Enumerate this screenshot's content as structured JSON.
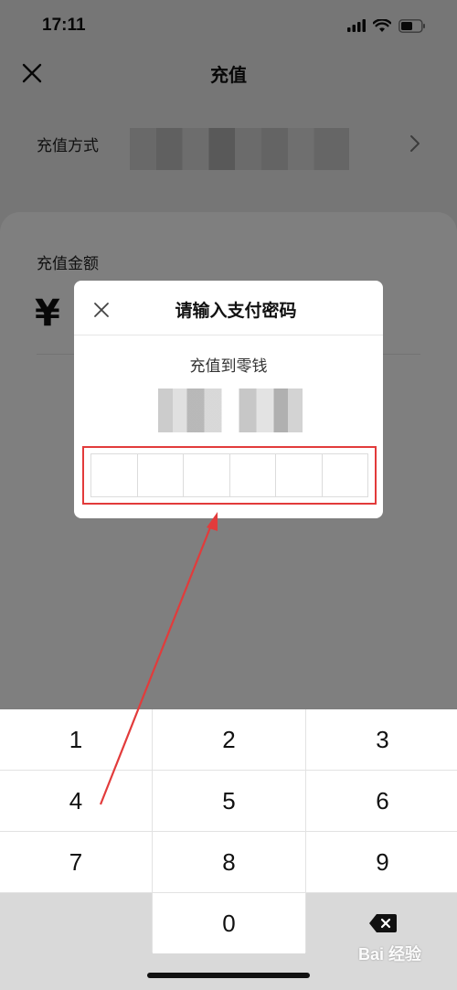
{
  "status_bar": {
    "time": "17:11",
    "icons": [
      "signal-icon",
      "wifi-icon",
      "battery-icon"
    ]
  },
  "nav": {
    "title": "充值",
    "close_icon": "close-icon"
  },
  "recharge_method": {
    "label": "充值方式",
    "value_redacted": true,
    "chevron_icon": "chevron-right-icon"
  },
  "amount": {
    "label": "充值金额",
    "currency_symbol": "¥"
  },
  "password_dialog": {
    "title": "请输入支付密码",
    "subtitle": "充值到零钱",
    "amount_redacted": true,
    "pin_length": 6,
    "highlight_color": "#e23b3b"
  },
  "keypad": {
    "keys": [
      "1",
      "2",
      "3",
      "4",
      "5",
      "6",
      "7",
      "8",
      "9",
      "",
      "0",
      "delete"
    ]
  },
  "watermark": {
    "text": "Bai 经验"
  },
  "colors": {
    "overlay": "rgba(0,0,0,0.5)",
    "annotation": "#e23b3b"
  }
}
